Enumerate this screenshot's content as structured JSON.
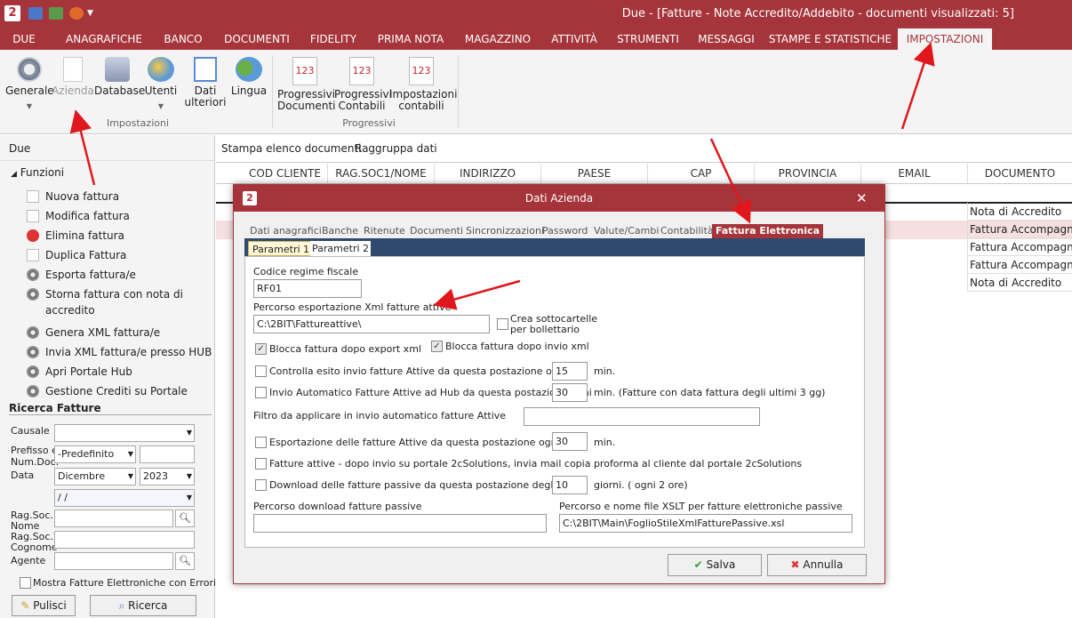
{
  "app": {
    "logo": "2",
    "title": "Due - [Fatture - Note Accredito/Addebito - documenti visualizzati: 5]"
  },
  "ribbon_tabs": [
    "DUE",
    "ANAGRAFICHE",
    "BANCO",
    "DOCUMENTI",
    "FIDELITY",
    "PRIMA NOTA",
    "MAGAZZINO",
    "ATTIVITÀ",
    "STRUMENTI",
    "MESSAGGI",
    "STAMPE E STATISTICHE",
    "IMPOSTAZIONI"
  ],
  "ribbon": {
    "generale": "Generale",
    "azienda": "Azienda",
    "database": "Database",
    "utenti": "Utenti",
    "dati_ulteriori_1": "Dati",
    "dati_ulteriori_2": "ulteriori",
    "lingua": "Lingua",
    "group_impostazioni": "Impostazioni",
    "prog_doc_1": "Progressivi",
    "prog_doc_2": "Documenti",
    "prog_cont_1": "Progressivi",
    "prog_cont_2": "Contabili",
    "imp_cont_1": "Impostazioni",
    "imp_cont_2": "contabili",
    "group_progressivi": "Progressivi",
    "icon_123": "123"
  },
  "left": {
    "header": "Due",
    "funzioni": "Funzioni",
    "items": [
      "Nuova fattura",
      "Modifica fattura",
      "Elimina fattura",
      "Duplica Fattura",
      "Esporta fattura/e",
      "Storna fattura con nota di accredito",
      "Genera XML fattura/e",
      "Invia XML fattura/e presso HUB",
      "Apri Portale Hub",
      "Gestione Crediti su Portale"
    ],
    "ricerca": "Ricerca Fatture",
    "causale": "Causale",
    "prefisso_1": "Prefisso e",
    "prefisso_2": "Num.Doc.",
    "prefisso_value": "-Predefinito",
    "data": "Data",
    "month": "Dicembre",
    "year": "2023",
    "date_value": "  /  /",
    "ragsoc1_1": "Rag.Soc.1",
    "ragsoc1_2": "Nome",
    "ragsoc2_1": "Rag.Soc.2",
    "ragsoc2_2": "Cognome",
    "agente": "Agente",
    "mostra_errori": "Mostra Fatture Elettroniche con Errori",
    "pulisci": "Pulisci",
    "ricerca_btn": "Ricerca"
  },
  "grid": {
    "toolbar": [
      "Stampa elenco documenti",
      "Raggruppa dati"
    ],
    "columns": [
      "COD CLIENTE",
      "RAG.SOC1/NOME",
      "INDIRIZZO",
      "PAESE",
      "CAP",
      "PROVINCIA",
      "EMAIL",
      "DOCUMENTO"
    ],
    "documento_values": [
      "Nota di Accredito",
      "Fattura Accompagn...",
      "Fattura Accompagn...",
      "Fattura Accompagn...",
      "Nota di Accredito"
    ]
  },
  "dialog": {
    "logo": "2",
    "title": "Dati Azienda",
    "close": "✕",
    "tabs": [
      "Dati anagrafici",
      "Banche",
      "Ritenute",
      "Documenti",
      "Sincronizzazioni",
      "Password",
      "Valute/Cambi",
      "Contabilità",
      "Fattura Elettronica"
    ],
    "subtabs": [
      "Parametri 1",
      "Parametri 2"
    ],
    "codice_regime_label": "Codice regime fiscale",
    "codice_regime_value": "RF01",
    "percorso_label": "Percorso esportazione Xml fatture attive",
    "percorso_value": "C:\\2BIT\\Fattureattive\\",
    "crea_sotto_1": "Crea sottocartelle",
    "crea_sotto_2": "per bollettario",
    "blocca_export": "Blocca fattura dopo export xml",
    "blocca_invio": "Blocca fattura dopo invio xml",
    "controlla_esito": "Controlla esito invio fatture Attive da questa postazione ogni",
    "controlla_value": "15",
    "min": "min.",
    "invio_auto": "Invio Automatico Fatture Attive ad Hub da questa postazione ogni",
    "invio_value": "30",
    "invio_note": "min. (Fatture con data fattura degli ultimi 3 gg)",
    "filtro": "Filtro da applicare in invio automatico fatture Attive",
    "export_attive": "Esportazione delle fatture Attive da questa postazione ogni",
    "export_value": "30",
    "fatture_mail": "Fatture attive - dopo invio su portale 2cSolutions, invia mail copia proforma al cliente dal portale 2cSolutions",
    "download_passive": "Download delle fatture passive da questa postazione degli ultimi",
    "download_value": "10",
    "giorni": "giorni. ( ogni 2 ore)",
    "percorso_download": "Percorso download fatture passive",
    "percorso_xslt": "Percorso e nome file XSLT per fatture elettroniche passive",
    "xslt_value": "C:\\2BIT\\Main\\FoglioStileXmlFatturePassive.xsl",
    "salva": "Salva",
    "annulla": "Annulla"
  },
  "colors": {
    "accent": "#a5353b",
    "arrow": "#e0171d"
  }
}
